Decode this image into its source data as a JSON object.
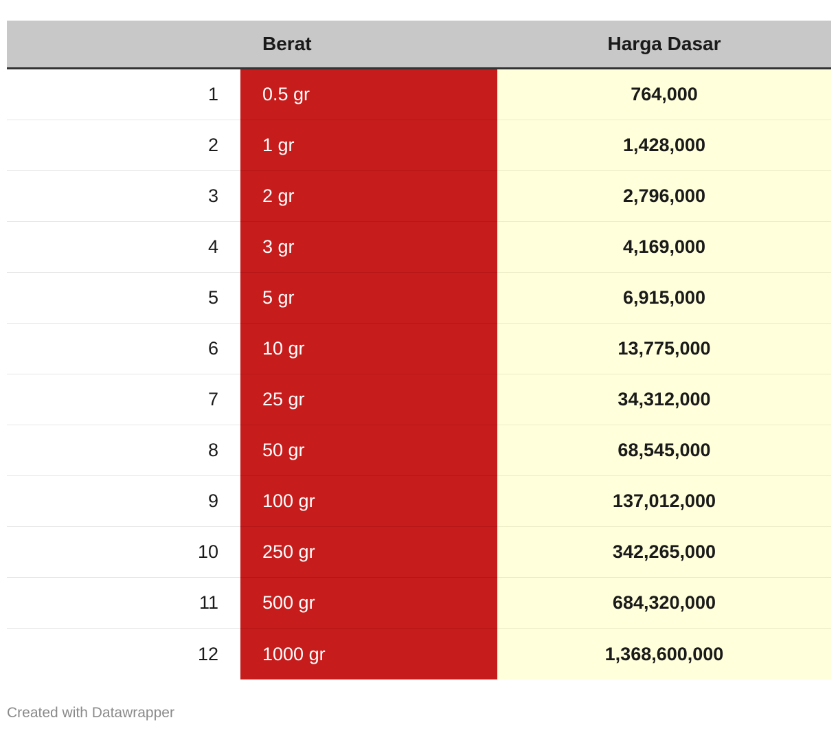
{
  "chart_data": {
    "type": "table",
    "columns": [
      "",
      "Berat",
      "Harga Dasar"
    ],
    "rows": [
      {
        "no": "1",
        "berat": "0.5 gr",
        "harga": "764,000"
      },
      {
        "no": "2",
        "berat": "1 gr",
        "harga": "1,428,000"
      },
      {
        "no": "3",
        "berat": "2 gr",
        "harga": "2,796,000"
      },
      {
        "no": "4",
        "berat": "3 gr",
        "harga": "4,169,000"
      },
      {
        "no": "5",
        "berat": "5 gr",
        "harga": "6,915,000"
      },
      {
        "no": "6",
        "berat": "10 gr",
        "harga": "13,775,000"
      },
      {
        "no": "7",
        "berat": "25 gr",
        "harga": "34,312,000"
      },
      {
        "no": "8",
        "berat": "50 gr",
        "harga": "68,545,000"
      },
      {
        "no": "9",
        "berat": "100 gr",
        "harga": "137,012,000"
      },
      {
        "no": "10",
        "berat": "250 gr",
        "harga": "342,265,000"
      },
      {
        "no": "11",
        "berat": "500 gr",
        "harga": "684,320,000"
      },
      {
        "no": "12",
        "berat": "1000 gr",
        "harga": "1,368,600,000"
      }
    ],
    "colors": {
      "header_bg": "#c8c8c8",
      "berat_bg": "#c61c1c",
      "harga_bg": "#ffffdb"
    }
  },
  "footer": {
    "credit": "Created with Datawrapper"
  }
}
